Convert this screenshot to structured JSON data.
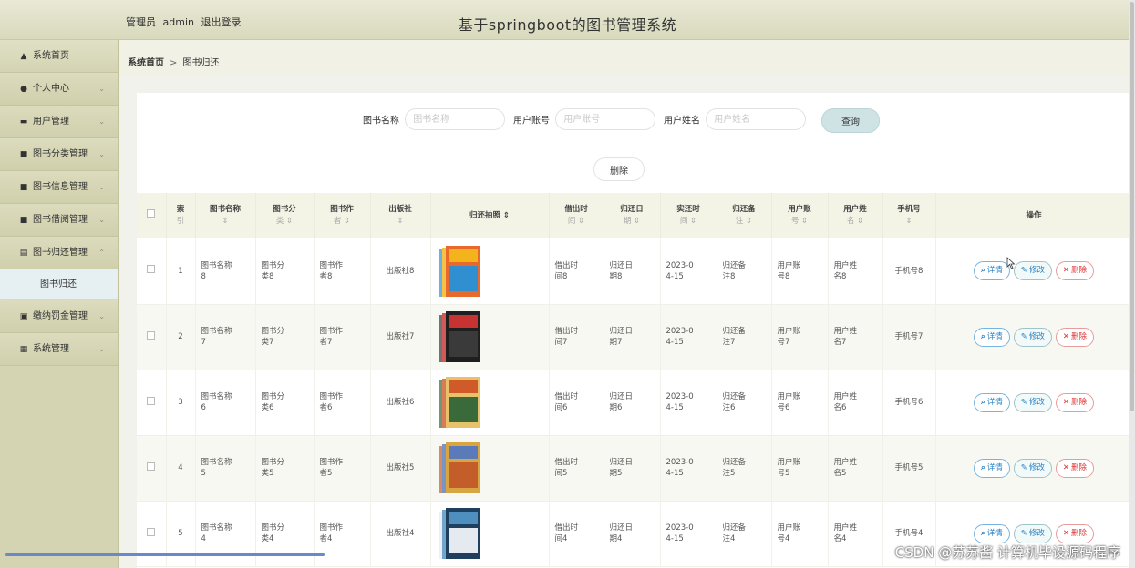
{
  "header": {
    "role": "管理员",
    "username": "admin",
    "logout": "退出登录",
    "title": "基于springboot的图书管理系统"
  },
  "sidebar": {
    "items": [
      {
        "label": "系统首页",
        "icon": "home-icon",
        "chev": ""
      },
      {
        "label": "个人中心",
        "icon": "user-icon",
        "chev": "⌄"
      },
      {
        "label": "用户管理",
        "icon": "users-icon",
        "chev": "⌄"
      },
      {
        "label": "图书分类管理",
        "icon": "grid-icon",
        "chev": "⌄"
      },
      {
        "label": "图书信息管理",
        "icon": "grid-icon",
        "chev": "⌄"
      },
      {
        "label": "图书借阅管理",
        "icon": "grid-icon",
        "chev": "⌄"
      },
      {
        "label": "图书归还管理",
        "icon": "book-icon",
        "chev": "⌃"
      }
    ],
    "sub": "图书归还",
    "items2": [
      {
        "label": "缴纳罚金管理",
        "icon": "wallet-icon",
        "chev": "⌄"
      },
      {
        "label": "系统管理",
        "icon": "table-icon",
        "chev": "⌄"
      }
    ]
  },
  "breadcrumb": {
    "home": "系统首页",
    "sep": ">",
    "current": "图书归还"
  },
  "search": {
    "book_label": "图书名称",
    "book_ph": "图书名称",
    "account_label": "用户账号",
    "account_ph": "用户账号",
    "name_label": "用户姓名",
    "name_ph": "用户姓名",
    "query": "查询"
  },
  "delete_label": "删除",
  "columns": [
    {
      "l1": "索",
      "l2": "引"
    },
    {
      "l1": "图书名称",
      "l2": "⇕"
    },
    {
      "l1": "图书分",
      "l2": "类 ⇕"
    },
    {
      "l1": "图书作",
      "l2": "者 ⇕"
    },
    {
      "l1": "出版社",
      "l2": "⇕"
    },
    {
      "l1": "归还拍照 ⇕",
      "l2": ""
    },
    {
      "l1": "借出时",
      "l2": "间 ⇕"
    },
    {
      "l1": "归还日",
      "l2": "期 ⇕"
    },
    {
      "l1": "实还时",
      "l2": "间 ⇕"
    },
    {
      "l1": "归还备",
      "l2": "注 ⇕"
    },
    {
      "l1": "用户账",
      "l2": "号 ⇕"
    },
    {
      "l1": "用户姓",
      "l2": "名 ⇕"
    },
    {
      "l1": "手机号",
      "l2": "⇕"
    },
    {
      "l1": "操作",
      "l2": ""
    }
  ],
  "rows": [
    {
      "idx": "1",
      "name": [
        "图书名称",
        "8"
      ],
      "cat": [
        "图书分",
        "类8"
      ],
      "author": [
        "图书作",
        "者8"
      ],
      "pub": "出版社8",
      "cover": "cover-8",
      "lend": [
        "借出时",
        "间8"
      ],
      "ret": [
        "归还日",
        "期8"
      ],
      "actual": [
        "2023-0",
        "4-15"
      ],
      "note": [
        "归还备",
        "注8"
      ],
      "acct": [
        "用户账",
        "号8"
      ],
      "uname": [
        "用户姓",
        "名8"
      ],
      "phone": "手机号8"
    },
    {
      "idx": "2",
      "name": [
        "图书名称",
        "7"
      ],
      "cat": [
        "图书分",
        "类7"
      ],
      "author": [
        "图书作",
        "者7"
      ],
      "pub": "出版社7",
      "cover": "cover-7",
      "lend": [
        "借出时",
        "间7"
      ],
      "ret": [
        "归还日",
        "期7"
      ],
      "actual": [
        "2023-0",
        "4-15"
      ],
      "note": [
        "归还备",
        "注7"
      ],
      "acct": [
        "用户账",
        "号7"
      ],
      "uname": [
        "用户姓",
        "名7"
      ],
      "phone": "手机号7"
    },
    {
      "idx": "3",
      "name": [
        "图书名称",
        "6"
      ],
      "cat": [
        "图书分",
        "类6"
      ],
      "author": [
        "图书作",
        "者6"
      ],
      "pub": "出版社6",
      "cover": "cover-6",
      "lend": [
        "借出时",
        "间6"
      ],
      "ret": [
        "归还日",
        "期6"
      ],
      "actual": [
        "2023-0",
        "4-15"
      ],
      "note": [
        "归还备",
        "注6"
      ],
      "acct": [
        "用户账",
        "号6"
      ],
      "uname": [
        "用户姓",
        "名6"
      ],
      "phone": "手机号6"
    },
    {
      "idx": "4",
      "name": [
        "图书名称",
        "5"
      ],
      "cat": [
        "图书分",
        "类5"
      ],
      "author": [
        "图书作",
        "者5"
      ],
      "pub": "出版社5",
      "cover": "cover-5",
      "lend": [
        "借出时",
        "间5"
      ],
      "ret": [
        "归还日",
        "期5"
      ],
      "actual": [
        "2023-0",
        "4-15"
      ],
      "note": [
        "归还备",
        "注5"
      ],
      "acct": [
        "用户账",
        "号5"
      ],
      "uname": [
        "用户姓",
        "名5"
      ],
      "phone": "手机号5"
    },
    {
      "idx": "5",
      "name": [
        "图书名称",
        "4"
      ],
      "cat": [
        "图书分",
        "类4"
      ],
      "author": [
        "图书作",
        "者4"
      ],
      "pub": "出版社4",
      "cover": "cover-4",
      "lend": [
        "借出时",
        "间4"
      ],
      "ret": [
        "归还日",
        "期4"
      ],
      "actual": [
        "2023-0",
        "4-15"
      ],
      "note": [
        "归还备",
        "注4"
      ],
      "acct": [
        "用户账",
        "号4"
      ],
      "uname": [
        "用户姓",
        "名4"
      ],
      "phone": "手机号4"
    }
  ],
  "ops": {
    "detail": "详情",
    "edit": "修改",
    "remove": "删除"
  },
  "watermark": "CSDN @苏苏酱   计算机毕设源码程序",
  "colors": {
    "header": "#e0e0c8",
    "sidebar": "#d4d4b3",
    "active_sub": "#e6eff2",
    "accent_blue": "#2b83c4",
    "danger": "#dd3333"
  }
}
